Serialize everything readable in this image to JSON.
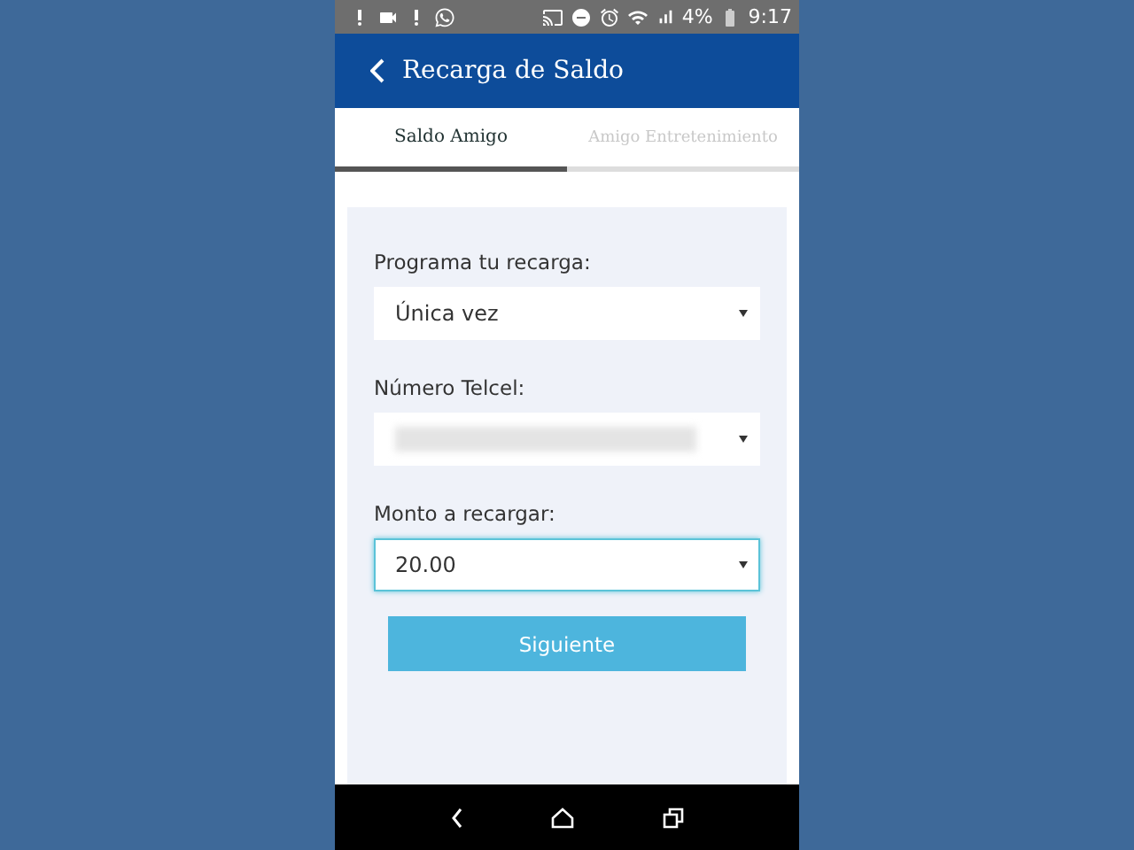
{
  "status_bar": {
    "battery": "4%",
    "time": "9:17"
  },
  "header": {
    "title": "Recarga de Saldo"
  },
  "tabs": [
    {
      "label": "Saldo Amigo",
      "selected": true
    },
    {
      "label": "Amigo Entretenimiento",
      "selected": false
    }
  ],
  "form": {
    "fields": [
      {
        "label": "Programa tu recarga:",
        "value": "Única vez",
        "focused": false,
        "kind": "select"
      },
      {
        "label": "Número Telcel:",
        "focused": false,
        "kind": "blurred"
      },
      {
        "label": "Monto a recargar:",
        "value": "20.00",
        "focused": true,
        "kind": "select"
      }
    ],
    "button": "Siguiente"
  }
}
